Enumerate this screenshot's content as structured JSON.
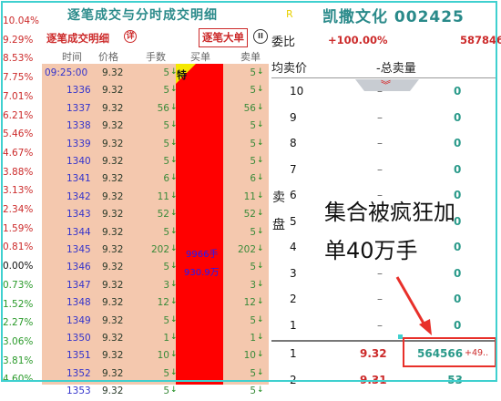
{
  "title": {
    "main": "逐笔成交与分时成交明细",
    "mark": "R",
    "brand": "凯撒文化 002425"
  },
  "scale": [
    "10.04%",
    "9.29%",
    "8.53%",
    "7.75%",
    "7.01%",
    "6.21%",
    "5.46%",
    "4.67%",
    "3.88%",
    "3.13%",
    "2.34%",
    "1.59%",
    "0.81%",
    "0.00%",
    "0.73%",
    "1.52%",
    "2.27%",
    "3.06%",
    "3.81%",
    "4.60%"
  ],
  "left_panel": {
    "title": "逐笔成交明细",
    "info_icon": "详",
    "big_order_button": "逐笔大单",
    "pause_icon": "II",
    "columns": [
      "时间",
      "价格",
      "手数",
      "买单",
      "卖单"
    ],
    "first_row": {
      "time": "09:25:00",
      "price": "9.32",
      "hands": "5",
      "buy": "特",
      "sell": "5"
    },
    "rows": [
      {
        "id": "1336",
        "price": "9.32",
        "hands": "5",
        "sell": "5"
      },
      {
        "id": "1337",
        "price": "9.32",
        "hands": "56",
        "sell": "56"
      },
      {
        "id": "1338",
        "price": "9.32",
        "hands": "5",
        "sell": "5"
      },
      {
        "id": "1339",
        "price": "9.32",
        "hands": "5",
        "sell": "5"
      },
      {
        "id": "1340",
        "price": "9.32",
        "hands": "5",
        "sell": "5"
      },
      {
        "id": "1341",
        "price": "9.32",
        "hands": "6",
        "sell": "6"
      },
      {
        "id": "1342",
        "price": "9.32",
        "hands": "11",
        "sell": "11"
      },
      {
        "id": "1343",
        "price": "9.32",
        "hands": "52",
        "sell": "52"
      },
      {
        "id": "1344",
        "price": "9.32",
        "hands": "5",
        "sell": "5"
      },
      {
        "id": "1345",
        "price": "9.32",
        "hands": "202",
        "sell": "202"
      },
      {
        "id": "1346",
        "price": "9.32",
        "hands": "5",
        "sell": "5"
      },
      {
        "id": "1347",
        "price": "9.32",
        "hands": "3",
        "sell": "3"
      },
      {
        "id": "1348",
        "price": "9.32",
        "hands": "12",
        "sell": "12"
      },
      {
        "id": "1349",
        "price": "9.32",
        "hands": "5",
        "sell": "5"
      },
      {
        "id": "1350",
        "price": "9.32",
        "hands": "1",
        "sell": "1"
      },
      {
        "id": "1351",
        "price": "9.32",
        "hands": "10",
        "sell": "10"
      },
      {
        "id": "1352",
        "price": "9.32",
        "hands": "5",
        "sell": "5"
      },
      {
        "id": "1353",
        "price": "9.32",
        "hands": "5",
        "sell": "5"
      }
    ],
    "buy_note_hands": "9966手",
    "buy_note_amount": "930.9万"
  },
  "right_panel": {
    "weibi_label": "委比",
    "weibi_value": "+100.00%",
    "weibi_right": "587846",
    "avg_sell_label": "均卖价",
    "total_sell_label": "-总卖量",
    "sell_side": [
      "卖",
      "盘"
    ],
    "sell_levels": [
      {
        "level": "10",
        "price": "–",
        "qty": "0"
      },
      {
        "level": "9",
        "price": "–",
        "qty": "0"
      },
      {
        "level": "8",
        "price": "–",
        "qty": "0"
      },
      {
        "level": "7",
        "price": "–",
        "qty": "0"
      },
      {
        "level": "6",
        "price": "–",
        "qty": "0"
      },
      {
        "level": "5",
        "price": "–",
        "qty": "0"
      },
      {
        "level": "4",
        "price": "–",
        "qty": "0"
      },
      {
        "level": "3",
        "price": "–",
        "qty": "0"
      },
      {
        "level": "2",
        "price": "–",
        "qty": "0"
      },
      {
        "level": "1",
        "price": "–",
        "qty": "0"
      }
    ],
    "buy_levels": [
      {
        "level": "1",
        "price": "9.32",
        "qty": "564566",
        "extra": "+49.."
      },
      {
        "level": "2",
        "price": "9.31",
        "qty": "53",
        "extra": ""
      }
    ]
  },
  "annotation": {
    "line1": "集合被疯狂加",
    "line2": "单40万手"
  },
  "colors": {
    "frame": "#3fd0cf",
    "panel_bg": "#f4c8ae",
    "buy_bar": "#ff0000",
    "highlight": "#e8302a",
    "accent_red": "#cc2a2a",
    "qty_green": "#2a9a8a"
  }
}
